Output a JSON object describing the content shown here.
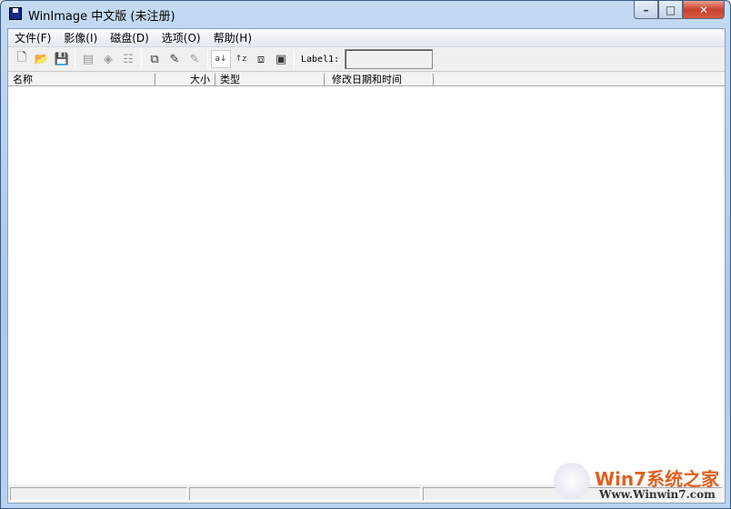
{
  "window": {
    "title": "WinImage 中文版 (未注册)",
    "minimize": "–",
    "maximize": "□",
    "close": "✕"
  },
  "menu": [
    "文件(F)",
    "影像(I)",
    "磁盘(D)",
    "选项(O)",
    "帮助(H)"
  ],
  "toolbar": {
    "icons": [
      "new-icon",
      "open-icon",
      "save-icon",
      "extract-icon",
      "inject-icon",
      "select-icon",
      "copy-disk-icon",
      "write-disk-icon",
      "format-disk-icon",
      "sort-name-icon",
      "sort-reverse-icon",
      "properties-icon",
      "info-icon"
    ],
    "label_text": "Label1:",
    "label_value": ""
  },
  "columns": [
    "名称",
    "大小",
    "类型",
    "修改日期和时间"
  ],
  "watermark": {
    "brand": "Win7系统之家",
    "url": "Www.Winwin7.com"
  }
}
